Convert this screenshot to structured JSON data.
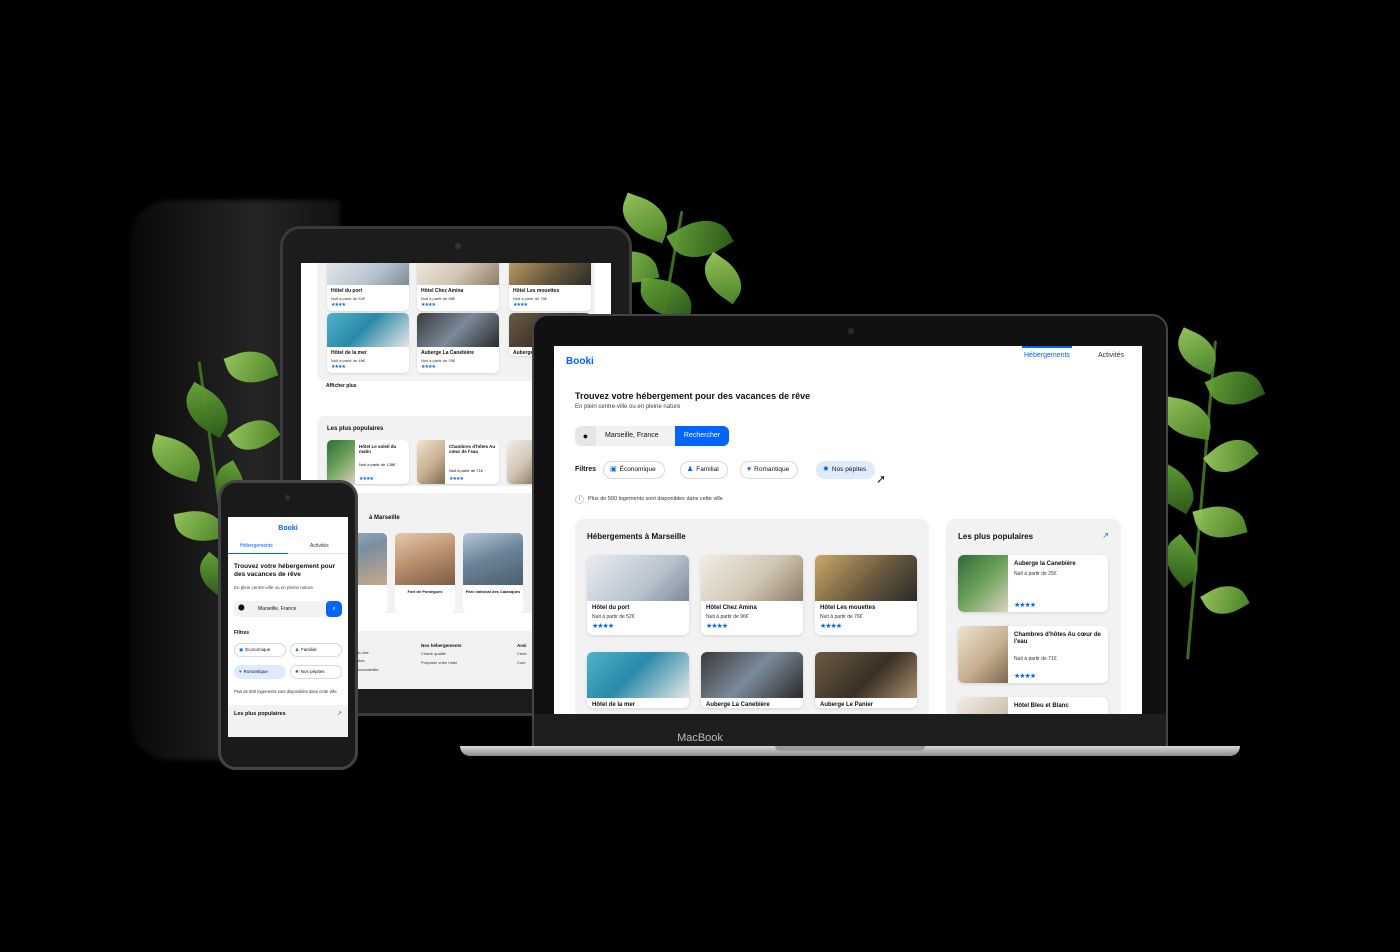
{
  "brand": "Booki",
  "nav": {
    "tab_accommodations": "Hébergements",
    "tab_activities": "Activités"
  },
  "hero": {
    "title": "Trouvez votre hébergement pour des vacances de rêve",
    "subtitle": "En plein centre-ville ou en pleine nature"
  },
  "search": {
    "value": "Marseille, France",
    "button_label": "Rechercher"
  },
  "filters": {
    "label": "Filtres",
    "items": [
      {
        "label": "Économique",
        "icon": "money-icon",
        "active": false
      },
      {
        "label": "Familial",
        "icon": "child-icon",
        "active": false
      },
      {
        "label": "Romantique",
        "icon": "heart-icon",
        "active": false
      },
      {
        "label": "Nos pépites",
        "icon": "fire-icon",
        "active": true
      }
    ]
  },
  "info_text": "Plus de 500 logements sont disponibles dans cette ville",
  "accommodations": {
    "title": "Hébergements à Marseille",
    "items": [
      {
        "name": "Hôtel du port",
        "price": "Nuit à partir de 52€",
        "stars": "★★★★"
      },
      {
        "name": "Hôtel Chez Amina",
        "price": "Nuit à partir de 96€",
        "stars": "★★★★"
      },
      {
        "name": "Hôtel Les mouettes",
        "price": "Nuit à partir de 76€",
        "stars": "★★★★"
      },
      {
        "name": "Hôtel de la mer",
        "price": "Nuit à partir de 46€",
        "stars": "★★★★"
      },
      {
        "name": "Auberge La Canebière",
        "price": "Nuit à partir de 25€",
        "stars": "★★★★"
      },
      {
        "name": "Auberge Le Panier",
        "price": "",
        "stars": ""
      }
    ],
    "show_more": "Afficher plus"
  },
  "popular": {
    "title": "Les plus populaires",
    "items": [
      {
        "name": "Auberge la Canebière",
        "price": "Nuit à partir de 25€",
        "stars": "★★★★"
      },
      {
        "name": "Chambres d'hôtes Au cœur de l'eau",
        "price": "Nuit à partir de 71€",
        "stars": "★★★★"
      },
      {
        "name": "Hôtel Bleu et Blanc",
        "price": "",
        "stars": ""
      }
    ],
    "tablet_items": [
      {
        "name": "Hôtel Le soleil du matin",
        "price": "Nuit à partir de 128€",
        "stars": "★★★★"
      },
      {
        "name": "Chambres d'hôtes Au cœur de l'eau",
        "price": "Nuit à partir de 71€",
        "stars": "★★★★"
      }
    ]
  },
  "activities": {
    "title": "Activités à Marseille",
    "title_visible": "à Marseille",
    "items": [
      {
        "name": ""
      },
      {
        "name": "Fort de Pomègues"
      },
      {
        "name": "Parc national des Calanques"
      }
    ]
  },
  "footer": {
    "col1": [
      "Fonctionnement du site",
      "Hébergements",
      "Activités",
      "Accessibilité"
    ],
    "col1_visible": [
      "du site",
      "ates",
      "accessibilité"
    ],
    "col2_title": "Nos hébergements",
    "col2": [
      "Charte qualité",
      "Proposer votre hôtel"
    ],
    "col3_title": "Assi",
    "col3": [
      "Centr",
      "Cont"
    ]
  },
  "device_brand": "MacBook",
  "colors": {
    "accent": "#0065fc",
    "chip_active": "#deebff",
    "panel_bg": "#f2f2f2"
  }
}
